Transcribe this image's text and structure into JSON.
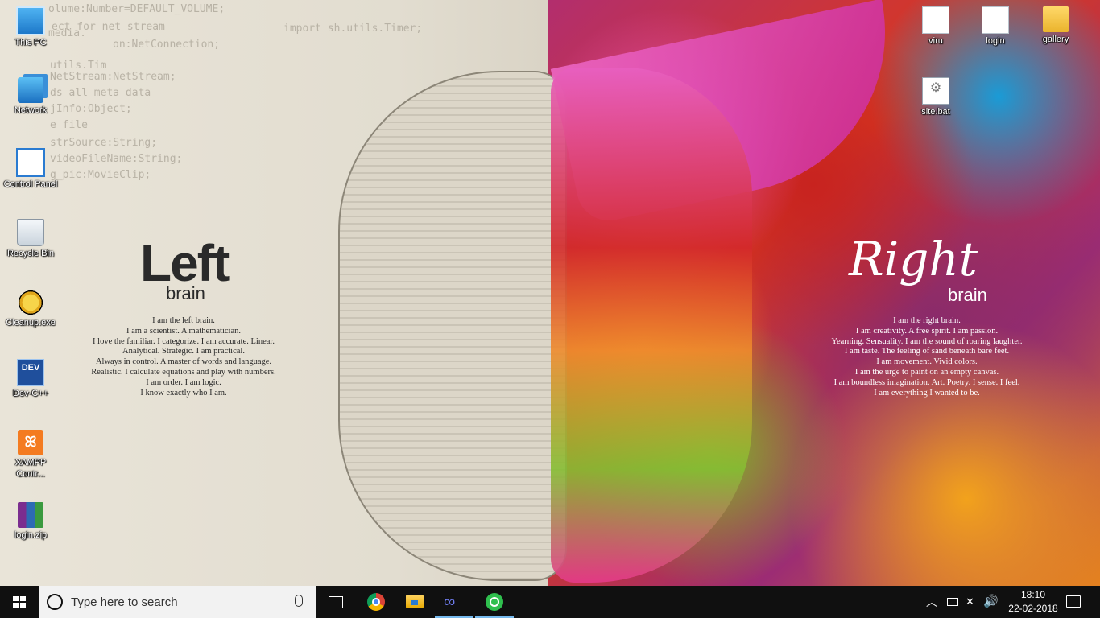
{
  "wallpaper": {
    "code_lines": [
      "olume:Number=DEFAULT_VOLUME;",
      "import sh.utils.Timer;",
      "ect for net stream",
      "media.",
      "on:NetConnection;",
      "utils.Tim",
      "NetStream:NetStream;",
      "ds all meta data",
      "jInfo:Object;",
      "e file",
      "strSource:String;",
      "videoFileName:String;",
      "g_pic:MovieClip;"
    ],
    "left": {
      "title": "Left",
      "subtitle": "brain",
      "lines": [
        "I am the left brain.",
        "I am a scientist. A mathematician.",
        "I love the familiar. I categorize. I am accurate. Linear.",
        "Analytical. Strategic. I am practical.",
        "Always in control. A master of words and language.",
        "Realistic. I calculate equations and play with numbers.",
        "I am order. I am logic.",
        "I know exactly who I am."
      ]
    },
    "right": {
      "title": "Right",
      "subtitle": "brain",
      "lines": [
        "I am the right brain.",
        "I am creativity. A free spirit. I am passion.",
        "Yearning. Sensuality. I am the sound of roaring laughter.",
        "I am taste. The feeling of sand beneath bare feet.",
        "I am movement. Vivid colors.",
        "I am the urge to paint on an empty canvas.",
        "I am boundless imagination. Art. Poetry. I sense. I feel.",
        "I am everything I wanted to be."
      ]
    }
  },
  "desktop": {
    "left_icons": [
      {
        "label": "This PC",
        "icon": "this-pc-icon"
      },
      {
        "label": "Network",
        "icon": "network-icon"
      },
      {
        "label": "Control Panel",
        "icon": "control-panel-icon"
      },
      {
        "label": "Recycle Bin",
        "icon": "recycle-bin-icon"
      },
      {
        "label": "Cleanup.exe",
        "icon": "cleanup-icon"
      },
      {
        "label": "Dev-C++",
        "icon": "dev-cpp-icon",
        "glyph": "DEV"
      },
      {
        "label": "XAMPP Contr...",
        "icon": "xampp-icon",
        "glyph": "ꕤ"
      },
      {
        "label": "login.zip",
        "icon": "winrar-archive-icon"
      }
    ],
    "right_icons": [
      {
        "label": "viru",
        "icon": "document-icon"
      },
      {
        "label": "login",
        "icon": "document-icon"
      },
      {
        "label": "gallery",
        "icon": "folder-icon"
      },
      {
        "label": "site.bat",
        "icon": "batch-file-icon",
        "glyph": "⚙"
      }
    ]
  },
  "taskbar": {
    "search_placeholder": "Type here to search",
    "pinned": [
      {
        "name": "task-view",
        "icon": "task-view-icon"
      },
      {
        "name": "chrome",
        "icon": "chrome-icon"
      },
      {
        "name": "file-explorer",
        "icon": "file-explorer-icon"
      },
      {
        "name": "infinity-app",
        "icon": "infinity-icon",
        "glyph": "∞"
      },
      {
        "name": "green-app",
        "icon": "green-circle-icon"
      }
    ],
    "tray": {
      "chevron": "︿",
      "network_glyph": "✕",
      "volume_glyph": "🔊",
      "time": "18:10",
      "date": "22-02-2018"
    },
    "colors": {
      "background": "#101010",
      "active": "#76b9ed"
    }
  }
}
